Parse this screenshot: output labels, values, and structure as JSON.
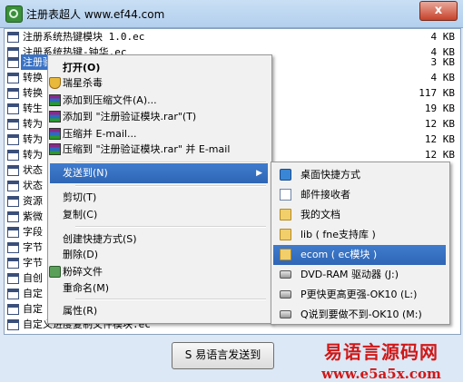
{
  "window": {
    "title": "注册表超人 www.ef44.com",
    "close_label": "x"
  },
  "files": [
    {
      "name": "注册系统热键模块 1.0.ec",
      "size": "4 KB"
    },
    {
      "name": "注册系统热键-钟华.ec",
      "size": "4 KB"
    },
    {
      "name": "注册验",
      "size": "3 KB",
      "selected": true
    },
    {
      "name": "转换",
      "size": "4 KB"
    },
    {
      "name": "转换",
      "size": "117 KB"
    },
    {
      "name": "转生",
      "size": "19 KB"
    },
    {
      "name": "转为",
      "size": "12 KB"
    },
    {
      "name": "转为",
      "size": "12 KB"
    },
    {
      "name": "转为",
      "size": "12 KB"
    },
    {
      "name": "状态",
      "size": ""
    },
    {
      "name": "状态",
      "size": ""
    },
    {
      "name": "资源",
      "size": ""
    },
    {
      "name": "紫微",
      "size": ""
    },
    {
      "name": "字段",
      "size": ""
    },
    {
      "name": "字节",
      "size": ""
    },
    {
      "name": "字节",
      "size": ""
    },
    {
      "name": "自创",
      "size": ""
    },
    {
      "name": "自定",
      "size": ""
    },
    {
      "name": "自定",
      "size": ""
    },
    {
      "name": "自定义进度复制文件模块.ec",
      "size": ""
    }
  ],
  "context_menu": {
    "open": "打开(O)",
    "ruixing": "瑞星杀毒",
    "add_archive": "添加到压缩文件(A)...",
    "add_rar": "添加到 \"注册验证模块.rar\"(T)",
    "compress_email": "压缩并 E-mail...",
    "compress_rar_email": "压缩到 \"注册验证模块.rar\" 并 E-mail",
    "send_to": "发送到(N)",
    "cut": "剪切(T)",
    "copy": "复制(C)",
    "create_shortcut": "创建快捷方式(S)",
    "delete": "删除(D)",
    "shred": "粉碎文件",
    "rename": "重命名(M)",
    "properties": "属性(R)"
  },
  "send_to_menu": {
    "desktop": "桌面快捷方式",
    "mail": "邮件接收者",
    "my_docs": "我的文档",
    "lib": "lib ( fne支持库 )",
    "ecom": "ecom ( ec模块 )",
    "dvd": "DVD-RAM 驱动器 (J:)",
    "p_drive": "P更快更高更强-OK10 (L:)",
    "q_drive": "Q说到要做不到-OK10 (M:)"
  },
  "bottom_button": "S 易语言发送到",
  "watermark": {
    "line1": "易语言源码网",
    "line2": "www.e5a5x.com"
  }
}
